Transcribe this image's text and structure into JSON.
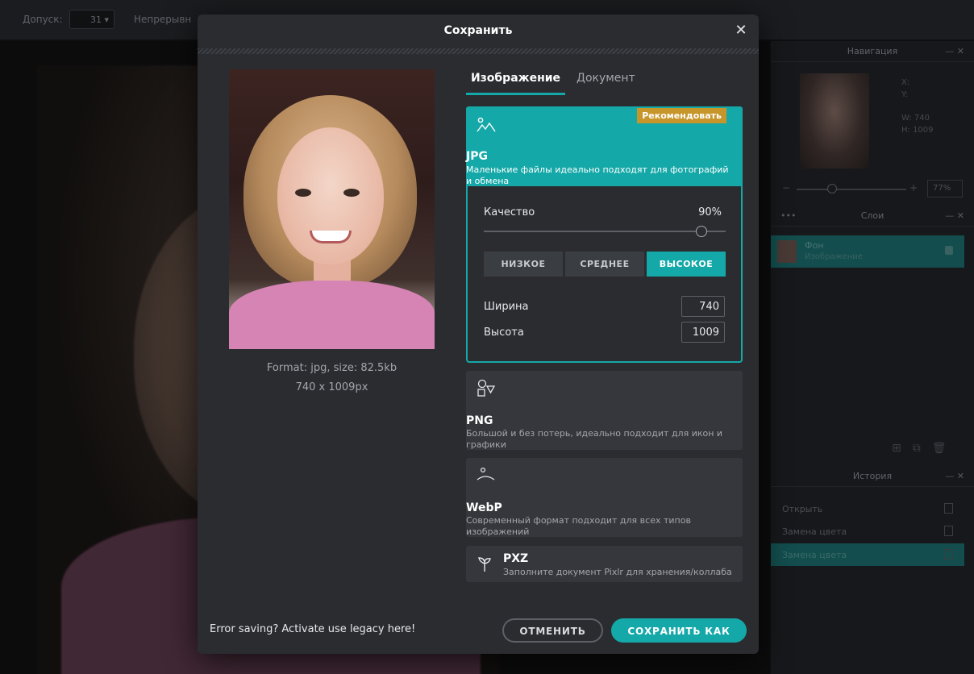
{
  "background": {
    "toolbar": {
      "tolerance_label": "Допуск:",
      "tolerance_value": "31 ▾",
      "continuous_label": "Непрерывн"
    },
    "navigation": {
      "title": "Навигация",
      "coords": [
        "X:",
        "Y:",
        "W: 740",
        "H: 1009"
      ],
      "zoom": "77%"
    },
    "layers": {
      "title": "Слои",
      "layer_name": "Фон",
      "layer_type": "Изображение"
    },
    "history": {
      "title": "История",
      "items": [
        "Открыть",
        "Замена цвета",
        "Замена цвета"
      ]
    }
  },
  "modal": {
    "title": "Сохранить",
    "preview": {
      "format_line": "Format: jpg, size: 82.5kb",
      "dimensions_line": "740 x 1009px"
    },
    "tabs": [
      {
        "label": "Изображение",
        "active": true
      },
      {
        "label": "Документ",
        "active": false
      }
    ],
    "formats": {
      "jpg": {
        "title": "JPG",
        "description": "Маленькие файлы идеально подходят для фотографий и обмена",
        "badge": "Рекомендовать",
        "icon": "image-mountain-icon"
      },
      "png": {
        "title": "PNG",
        "description": "Большой и без потерь, идеально подходит для икон и графики",
        "icon": "shapes-icon"
      },
      "webp": {
        "title": "WebP",
        "description": "Современный формат подходит для всех типов изображений",
        "icon": "webp-person-icon"
      },
      "pxz": {
        "title": "PXZ",
        "description": "Заполните документ Pixlr для хранения/коллаба",
        "icon": "pixlr-leaf-icon"
      }
    },
    "jpg_options": {
      "quality_label": "Качество",
      "quality_value": "90%",
      "quality_fraction": 0.9,
      "presets": [
        {
          "label": "НИЗКОЕ",
          "active": false
        },
        {
          "label": "СРЕДНЕЕ",
          "active": false
        },
        {
          "label": "ВЫСОКОЕ",
          "active": true
        }
      ],
      "width_label": "Ширина",
      "width_value": "740",
      "height_label": "Высота",
      "height_value": "1009"
    },
    "legacy_link": "Error saving? Activate use legacy here!",
    "cancel_label": "ОТМЕНИТЬ",
    "save_label": "СОХРАНИТЬ КАК",
    "colors": {
      "accent": "#15a8a8",
      "badge": "#c7962a",
      "modal_bg": "#2a2c30",
      "card_bg": "#35373c"
    }
  }
}
